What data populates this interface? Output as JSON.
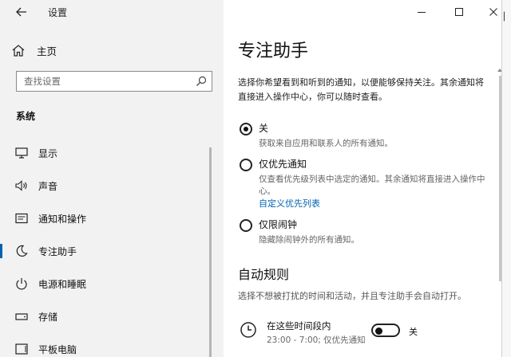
{
  "app": {
    "title": "设置"
  },
  "left": {
    "home_label": "主页",
    "search_placeholder": "查找设置",
    "section_label": "系统",
    "nav_items": [
      {
        "label": "显示",
        "icon": "monitor-icon"
      },
      {
        "label": "声音",
        "icon": "speaker-icon"
      },
      {
        "label": "通知和操作",
        "icon": "notification-icon"
      },
      {
        "label": "专注助手",
        "icon": "moon-icon",
        "selected": true
      },
      {
        "label": "电源和睡眠",
        "icon": "power-icon"
      },
      {
        "label": "存储",
        "icon": "storage-icon"
      },
      {
        "label": "平板电脑",
        "icon": "tablet-icon"
      }
    ]
  },
  "right": {
    "page_title": "专注助手",
    "intro": "选择你希望看到和听到的通知，以便能够保持关注。其余通知将直接进入操作中心，你可以随时查看。",
    "options": [
      {
        "label": "关",
        "desc": "获取来自应用和联系人的所有通知。",
        "checked": true
      },
      {
        "label": "仅优先通知",
        "desc": "仅查看优先级列表中选定的通知。其余通知将直接进入操作中心。",
        "link": "自定义优先列表",
        "checked": false
      },
      {
        "label": "仅限闹钟",
        "desc": "隐藏除闹钟外的所有通知。",
        "checked": false
      }
    ],
    "rules_title": "自动规则",
    "rules_desc": "选择不想被打扰的时间和活动，并且专注助手会自动打开。",
    "time_rule": {
      "title": "在这些时间段内",
      "subtitle": "23:00 - 7:00; 仅优先通知",
      "toggle_label": "关",
      "toggle_on": false
    }
  },
  "colors": {
    "accent": "#0063b1",
    "sidebar_bg": "#f2f2f2"
  }
}
